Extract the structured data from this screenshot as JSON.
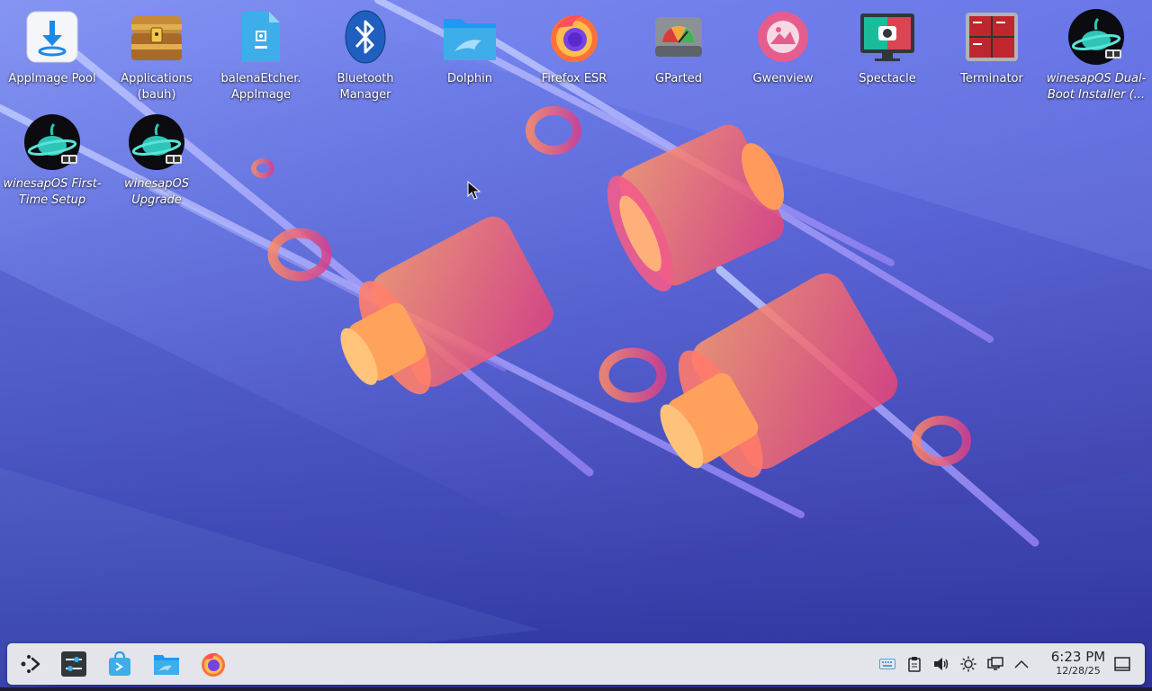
{
  "desktop": {
    "icons": [
      {
        "label": "AppImage Pool",
        "icon": "appimage-pool-icon"
      },
      {
        "label": "Applications (bauh)",
        "icon": "treasure-chest-icon"
      },
      {
        "label": "balenaEtcher. AppImage",
        "icon": "appimage-file-icon"
      },
      {
        "label": "Bluetooth Manager",
        "icon": "bluetooth-icon"
      },
      {
        "label": "Dolphin",
        "icon": "folder-dolphin-icon"
      },
      {
        "label": "Firefox ESR",
        "icon": "firefox-icon"
      },
      {
        "label": "GParted",
        "icon": "disk-gauge-icon"
      },
      {
        "label": "Gwenview",
        "icon": "gwenview-icon"
      },
      {
        "label": "Spectacle",
        "icon": "screenshot-camera-icon"
      },
      {
        "label": "Terminator",
        "icon": "terminal-grid-icon"
      },
      {
        "label": "winesapOS Dual-Boot Installer (...",
        "icon": "winesapos-planet-icon"
      },
      {
        "label": "winesapOS First-Time Setup",
        "icon": "winesapos-planet-icon"
      },
      {
        "label": "winesapOS Upgrade",
        "icon": "winesapos-planet-icon"
      }
    ]
  },
  "taskbar": {
    "launchers": [
      {
        "name": "application-launcher",
        "icon": "kde-launcher-icon"
      },
      {
        "name": "system-settings",
        "icon": "sliders-icon"
      },
      {
        "name": "discover",
        "icon": "store-bag-icon"
      },
      {
        "name": "dolphin",
        "icon": "folder-icon"
      },
      {
        "name": "firefox",
        "icon": "firefox-icon"
      }
    ],
    "tray": [
      "keyboard-icon",
      "clipboard-icon",
      "volume-icon",
      "brightness-icon",
      "network-icon",
      "chevron-up-icon"
    ],
    "clock": {
      "time": "6:23 PM",
      "date": "12/28/25"
    }
  },
  "colors": {
    "panel": "#e3e5ea",
    "text_on_desktop": "#ffffff",
    "accent_pink": "#f25c8a",
    "accent_orange": "#ff9a5c",
    "wallpaper_blue": "#4b57d8"
  }
}
